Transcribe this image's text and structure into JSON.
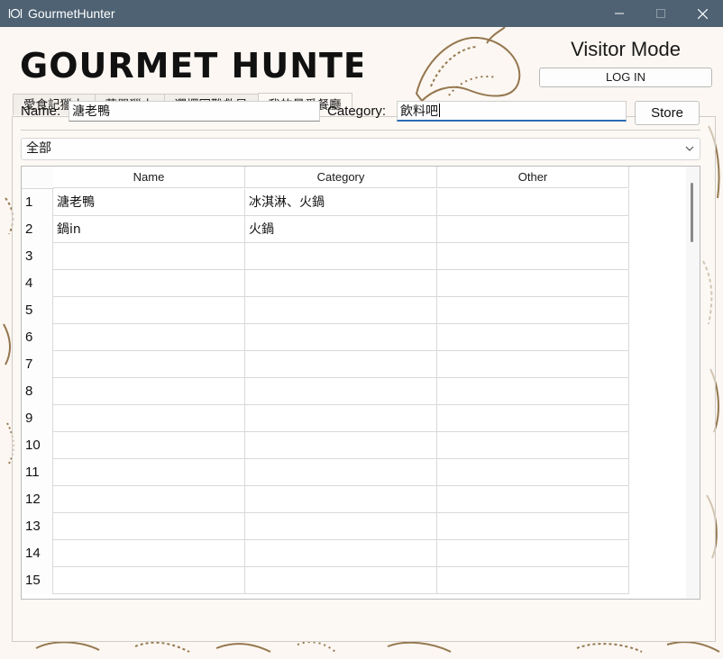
{
  "window": {
    "title": "GourmetHunter",
    "icon": "app-food-icon"
  },
  "header": {
    "logo_text": "GOURMET HUNTER",
    "mode_label": "Visitor Mode",
    "login_label": "LOG IN"
  },
  "tabs": [
    {
      "label": "愛食記獵人",
      "active": false
    },
    {
      "label": "菜單獵人",
      "active": false
    },
    {
      "label": "選擇困難救星",
      "active": false
    },
    {
      "label": "我的最愛餐廳",
      "active": true
    }
  ],
  "form": {
    "name_label": "Name:",
    "name_value": "溏老鴨",
    "category_label": "Category:",
    "category_value": "飲料吧",
    "store_label": "Store"
  },
  "filter": {
    "selected": "全部"
  },
  "table": {
    "columns": [
      "Name",
      "Category",
      "Other"
    ],
    "rows": [
      {
        "num": "1",
        "name": "溏老鴨",
        "category": " 冰淇淋、火鍋",
        "other": ""
      },
      {
        "num": "2",
        "name": "鍋in",
        "category": "火鍋",
        "other": ""
      },
      {
        "num": "3",
        "name": "",
        "category": "",
        "other": ""
      },
      {
        "num": "4",
        "name": "",
        "category": "",
        "other": ""
      },
      {
        "num": "5",
        "name": "",
        "category": "",
        "other": ""
      },
      {
        "num": "6",
        "name": "",
        "category": "",
        "other": ""
      },
      {
        "num": "7",
        "name": "",
        "category": "",
        "other": ""
      },
      {
        "num": "8",
        "name": "",
        "category": "",
        "other": ""
      },
      {
        "num": "9",
        "name": "",
        "category": "",
        "other": ""
      },
      {
        "num": "10",
        "name": "",
        "category": "",
        "other": ""
      },
      {
        "num": "11",
        "name": "",
        "category": "",
        "other": ""
      },
      {
        "num": "12",
        "name": "",
        "category": "",
        "other": ""
      },
      {
        "num": "13",
        "name": "",
        "category": "",
        "other": ""
      },
      {
        "num": "14",
        "name": "",
        "category": "",
        "other": ""
      },
      {
        "num": "15",
        "name": "",
        "category": "",
        "other": ""
      }
    ]
  },
  "colors": {
    "titlebar": "#4e6273",
    "focus_accent": "#2a6bb4",
    "art_stroke": "#8a6a3e"
  }
}
